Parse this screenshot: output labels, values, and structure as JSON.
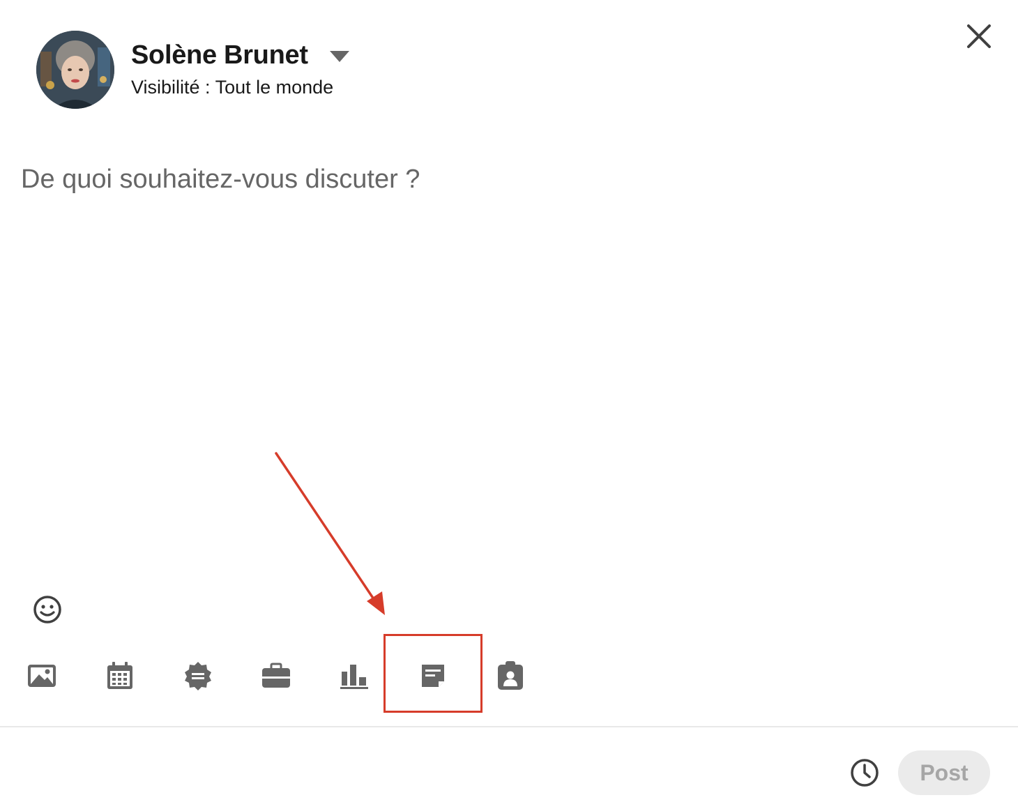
{
  "author": {
    "name": "Solène Brunet",
    "visibility": "Visibilité : Tout le monde"
  },
  "composer": {
    "placeholder": "De quoi souhaitez-vous discuter ?"
  },
  "toolbar": {
    "tools": [
      {
        "icon": "image-icon"
      },
      {
        "icon": "calendar-icon"
      },
      {
        "icon": "celebrate-badge-icon"
      },
      {
        "icon": "briefcase-icon"
      },
      {
        "icon": "poll-chart-icon"
      },
      {
        "icon": "document-note-icon",
        "highlighted": true
      },
      {
        "icon": "clipboard-person-icon"
      }
    ]
  },
  "footer": {
    "post_label": "Post"
  },
  "colors": {
    "icon": "#666666",
    "highlight": "#d63c2a",
    "post_disabled_bg": "#ebebeb",
    "post_disabled_text": "#a6a6a6"
  }
}
